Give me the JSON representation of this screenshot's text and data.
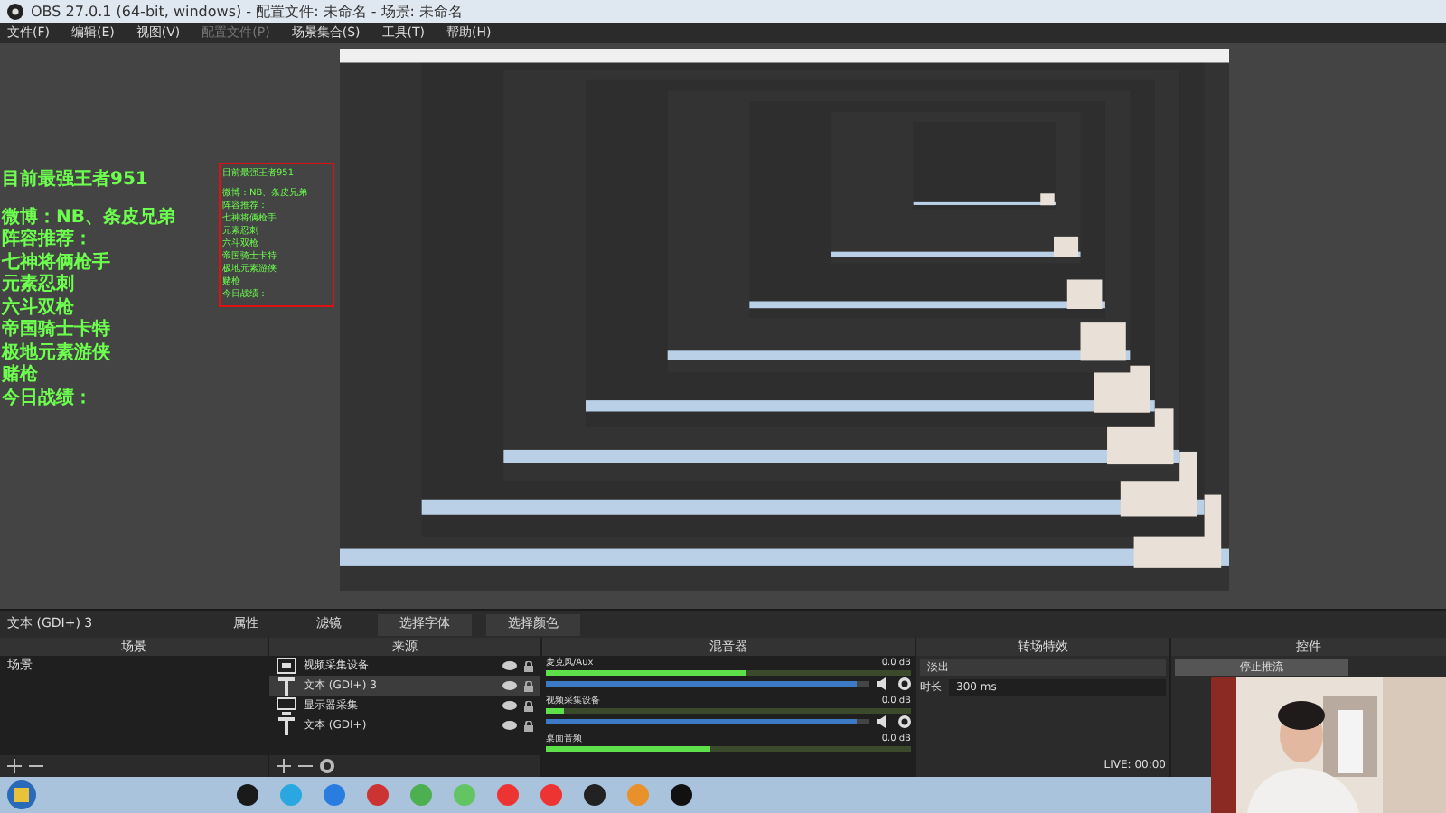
{
  "window": {
    "title": "OBS 27.0.1 (64-bit, windows) - 配置文件: 未命名 - 场景: 未命名"
  },
  "menu": [
    {
      "label": "文件(F)",
      "disabled": false
    },
    {
      "label": "编辑(E)",
      "disabled": false
    },
    {
      "label": "视图(V)",
      "disabled": false
    },
    {
      "label": "配置文件(P)",
      "disabled": true
    },
    {
      "label": "场景集合(S)",
      "disabled": false
    },
    {
      "label": "工具(T)",
      "disabled": false
    },
    {
      "label": "帮助(H)",
      "disabled": false
    }
  ],
  "preview": {
    "overlay_text": {
      "heading": "目前最强王者951",
      "lines": [
        "微博：NB、条皮兄弟",
        "阵容推荐：",
        "七神将俩枪手",
        "元素忍刺",
        "六斗双枪",
        "帝国骑士卡特",
        "极地元素游侠",
        "赌枪",
        "今日战绩："
      ]
    },
    "selected_source_text": {
      "heading": "目前最强王者951",
      "lines": [
        "微博：NB、条皮兄弟",
        "阵容推荐：",
        "七神将俩枪手",
        "元素忍刺",
        "六斗双枪",
        "帝国骑士卡特",
        "极地元素游侠",
        "赌枪",
        "今日战绩："
      ]
    }
  },
  "source_toolbar": {
    "source_name": "文本 (GDI+) 3",
    "buttons": [
      "属性",
      "滤镜",
      "选择字体",
      "选择颜色"
    ]
  },
  "scenes": {
    "title": "场景",
    "items": [
      {
        "label": "场景",
        "selected": false
      }
    ]
  },
  "sources": {
    "title": "来源",
    "items": [
      {
        "label": "视频采集设备",
        "kind": "camera",
        "selected": false
      },
      {
        "label": "文本 (GDI+) 3",
        "kind": "text",
        "selected": true
      },
      {
        "label": "显示器采集",
        "kind": "monitor",
        "selected": false
      },
      {
        "label": "文本 (GDI+)",
        "kind": "text",
        "selected": false
      }
    ]
  },
  "mixer": {
    "title": "混音器",
    "channels": [
      {
        "name": "麦克风/Aux",
        "reading": "0.0 dB",
        "level": 0.55,
        "volume": {
          "level": 0.96
        }
      },
      {
        "name": "视频采集设备",
        "reading": "0.0 dB",
        "level": 0.05,
        "volume": {
          "level": 0.96
        }
      },
      {
        "name": "桌面音频",
        "reading": "0.0 dB",
        "level": 0.45
      }
    ]
  },
  "transitions": {
    "title": "转场特效",
    "transition": "淡出",
    "duration_label": "时长",
    "duration": "300 ms"
  },
  "controls": {
    "title": "控件",
    "buttons": [
      "停止推流"
    ]
  },
  "status_bar": {
    "live": "LIVE: 00:00"
  }
}
